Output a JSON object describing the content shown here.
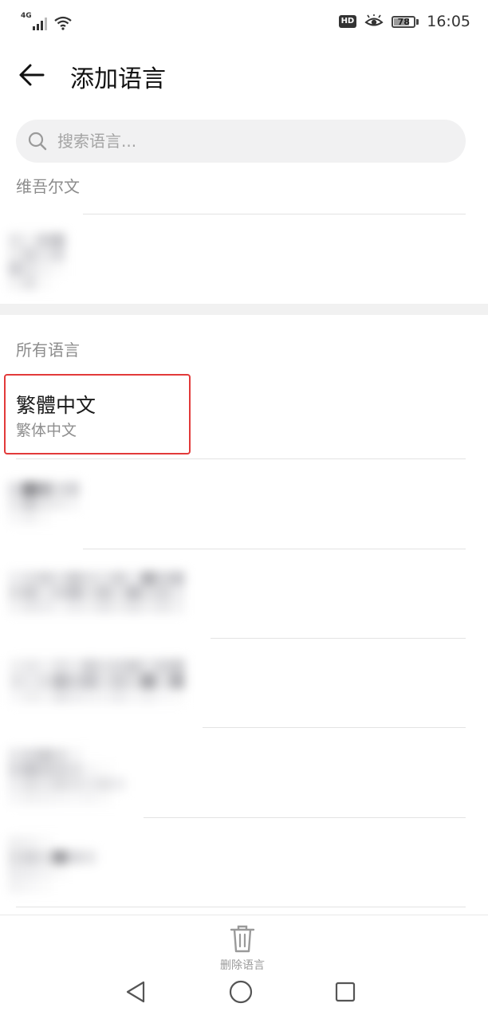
{
  "status_bar": {
    "network": "4G",
    "hd_badge": "HD",
    "battery_level": "78",
    "time": "16:05",
    "icons": [
      "signal-icon",
      "wifi-icon",
      "eye-comfort-icon",
      "battery-icon"
    ]
  },
  "header": {
    "title": "添加语言",
    "back_icon": "arrow-left-icon"
  },
  "search": {
    "placeholder": "搜索语言..."
  },
  "suggested": {
    "label": "维吾尔文"
  },
  "all_languages": {
    "label": "所有语言",
    "items": [
      {
        "title": "繁體中文",
        "subtitle": "繁体中文",
        "highlighted": true
      }
    ]
  },
  "bottom_bar": {
    "delete_label": "删除语言",
    "delete_icon": "trash-icon"
  },
  "nav_bar": {
    "icons": [
      "back-triangle-icon",
      "home-circle-icon",
      "recents-square-icon"
    ]
  },
  "colors": {
    "highlight_border": "#e23a3a",
    "section_label": "#8c8c8c",
    "divider": "#e3e3e3"
  }
}
